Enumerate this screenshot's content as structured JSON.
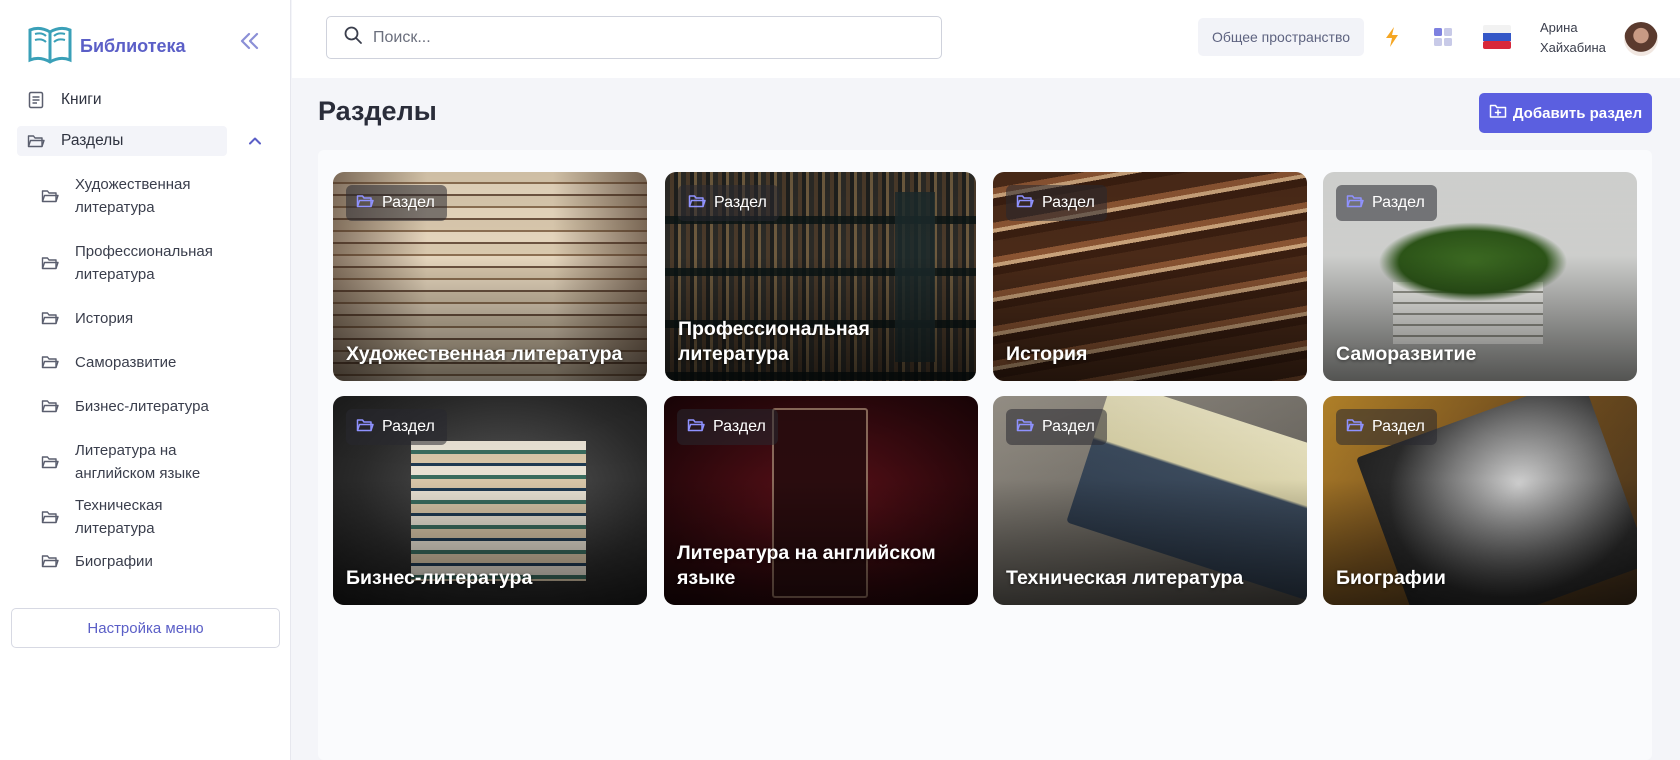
{
  "sidebar": {
    "brand": "Библиотека",
    "nav": {
      "books": "Книги",
      "sections": "Разделы"
    },
    "sub_items": [
      "Художественная литература",
      "Профессиональная литература",
      "История",
      "Саморазвитие",
      "Бизнес-литература",
      "Литература на английском языке",
      "Техническая литература",
      "Биографии"
    ],
    "menu_settings": "Настройка меню"
  },
  "topbar": {
    "search_placeholder": "Поиск...",
    "workspace": "Общее пространство",
    "user_first": "Арина",
    "user_last": "Хайхабина"
  },
  "main": {
    "title": "Разделы",
    "add_button": "Добавить раздел",
    "tag_label": "Раздел",
    "cards": [
      "Художественная литература",
      "Профессиональная литература",
      "История",
      "Саморазвитие",
      "Бизнес-литература",
      "Литература на английском языке",
      "Техническая литература",
      "Биографии"
    ]
  },
  "colors": {
    "accent": "#5b5fe0",
    "brand": "#5b5fc7",
    "background": "#f4f5f9"
  },
  "icons": [
    "book-logo-icon",
    "collapse-icon",
    "list-icon",
    "folder-icon",
    "chevron-up-icon",
    "search-icon",
    "lightning-icon",
    "grid-icon",
    "russia-flag-icon",
    "folder-plus-icon"
  ]
}
